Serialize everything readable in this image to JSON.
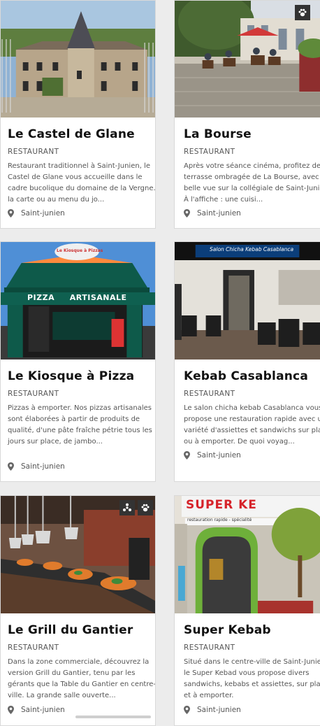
{
  "cards": [
    {
      "name": "Le Castel de Glane",
      "category": "RESTAURANT",
      "description": "Restaurant traditionnel à Saint-Junien, le Castel de Glane vous accueille dans le cadre bucolique du domaine de la Vergne. À la carte ou au menu du jo...",
      "location": "Saint-junien",
      "image": "château-icon"
    },
    {
      "name": "La Bourse",
      "category": "RESTAURANT",
      "description": "Après votre séance cinéma, profitez de la terrasse ombragée de La Bourse, avec sa belle vue sur la collégiale de Saint-Junien. À l'affiche : une cuisi...",
      "location": "Saint-junien",
      "image": "terrace-icon",
      "badges": [
        "paw-icon"
      ]
    },
    {
      "name": "Le Kiosque à Pizza",
      "category": "RESTAURANT",
      "description": "Pizzas à emporter. Nos pizzas artisanales sont élaborées à partir de produits de qualité, d'une pâte fraîche pétrie tous les jours sur place, de jambo...",
      "location": "Saint-junien",
      "image": "pizza-kiosk-icon",
      "sign_top": "Le Kiosque à Pizzas",
      "sign_main": "PIZZA     ARTISANALE"
    },
    {
      "name": "Kebab Casablanca",
      "category": "RESTAURANT",
      "description": "Le salon chicha kebab Casablanca vous propose une restauration rapide avec une variété d'assiettes et sandwichs sur place ou à emporter. De quoi voyag...",
      "location": "Saint-junien",
      "image": "kebab-interior-icon",
      "sign": "Salon Chicha Kebab Casablanca"
    },
    {
      "name": "Le Grill du Gantier",
      "category": "RESTAURANT",
      "description": "Dans la zone commerciale, découvrez la version Grill du Gantier, tenu par les gérants que la Table du Gantier en centre-ville. La grande salle ouverte...",
      "location": "Saint-junien",
      "image": "buffet-icon",
      "badges": [
        "wheelchair-icon",
        "paw-icon"
      ]
    },
    {
      "name": "Super Kebab",
      "category": "RESTAURANT",
      "description": "Situé dans le centre-ville de Saint-Junien, le Super Kebad vous propose divers sandwichs, kebabs et assiettes, sur place et à emporter.",
      "location": "Saint-junien",
      "image": "shopfront-icon",
      "sign": "SUPER KE",
      "sign_sub": "restauration rapide - spécialité"
    }
  ]
}
